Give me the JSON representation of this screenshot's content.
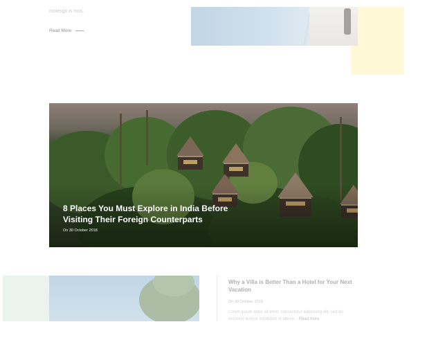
{
  "top": {
    "excerpt_tail": "molesgit is mos.",
    "read_more": "Read More"
  },
  "feature": {
    "title": "8 Places You Must Explore in India Before Visiting Their Foreign Counterparts",
    "date": "On 30 October 2018"
  },
  "post": {
    "title": "Why a Villa is Better Than a Hotel for Your Next Vacation",
    "date": "On 30 October 2018",
    "excerpt": "Lorem ipsum dolor sit amet, consectetur adipiscing elit, sed do eiusmod tempor incididunt ut labore...",
    "read_more": "Read more"
  },
  "colors": {
    "accent_yellow": "#fff9d8",
    "mint": "#eaf3ee",
    "white": "#ffffff"
  }
}
